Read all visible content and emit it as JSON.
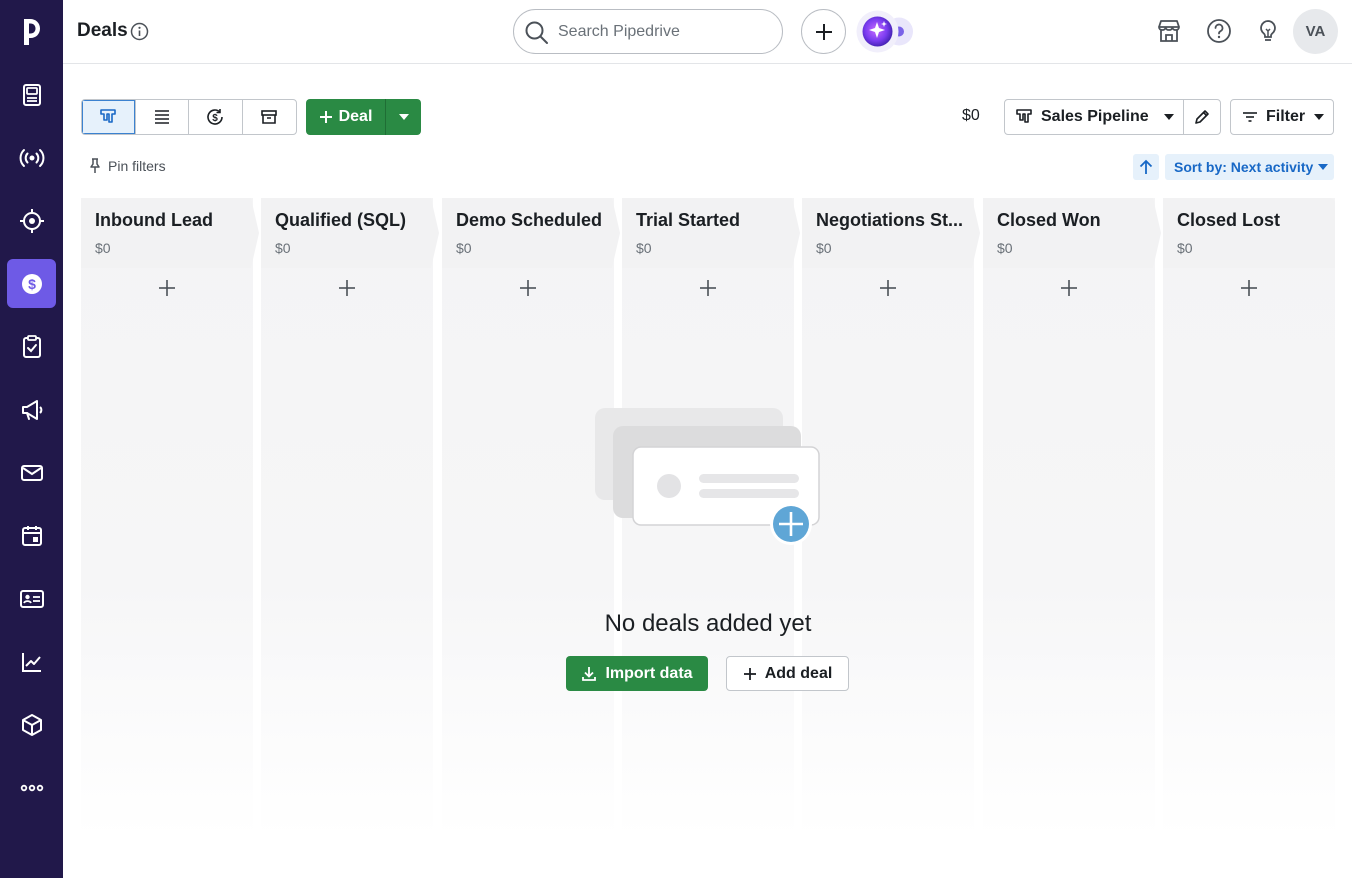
{
  "header": {
    "title": "Deals",
    "search_placeholder": "Search Pipedrive",
    "avatar_initials": "VA"
  },
  "sidebar": {
    "items": [
      {
        "name": "leads",
        "icon": "leads-inbox-icon"
      },
      {
        "name": "campaigns",
        "icon": "broadcast-icon"
      },
      {
        "name": "projects",
        "icon": "target-icon"
      },
      {
        "name": "deals",
        "icon": "dollar-icon",
        "active": true
      },
      {
        "name": "activities",
        "icon": "clipboard-check-icon"
      },
      {
        "name": "campaigns-marketing",
        "icon": "megaphone-icon"
      },
      {
        "name": "mail",
        "icon": "mail-icon"
      },
      {
        "name": "calendar",
        "icon": "calendar-icon"
      },
      {
        "name": "contacts",
        "icon": "contact-card-icon"
      },
      {
        "name": "insights",
        "icon": "chart-icon"
      },
      {
        "name": "products",
        "icon": "box-icon"
      },
      {
        "name": "more",
        "icon": "more-dots-icon"
      }
    ]
  },
  "toolbar": {
    "deal_label": "Deal",
    "total_value": "$0",
    "pipeline_label": "Sales Pipeline",
    "filter_label": "Filter",
    "pin_filters_label": "Pin filters",
    "sort_label": "Sort by: Next activity"
  },
  "stages": [
    {
      "name": "Inbound Lead",
      "amount": "$0"
    },
    {
      "name": "Qualified (SQL)",
      "amount": "$0"
    },
    {
      "name": "Demo Scheduled",
      "amount": "$0"
    },
    {
      "name": "Trial Started",
      "amount": "$0"
    },
    {
      "name": "Negotiations St...",
      "amount": "$0"
    },
    {
      "name": "Closed Won",
      "amount": "$0"
    },
    {
      "name": "Closed Lost",
      "amount": "$0"
    }
  ],
  "empty_state": {
    "title": "No deals added yet",
    "import_label": "Import data",
    "add_deal_label": "Add deal"
  },
  "colors": {
    "sidebar_bg": "#21184a",
    "sidebar_active": "#6e5ae6",
    "primary_green": "#2a8a44",
    "link_blue": "#1868c6"
  }
}
